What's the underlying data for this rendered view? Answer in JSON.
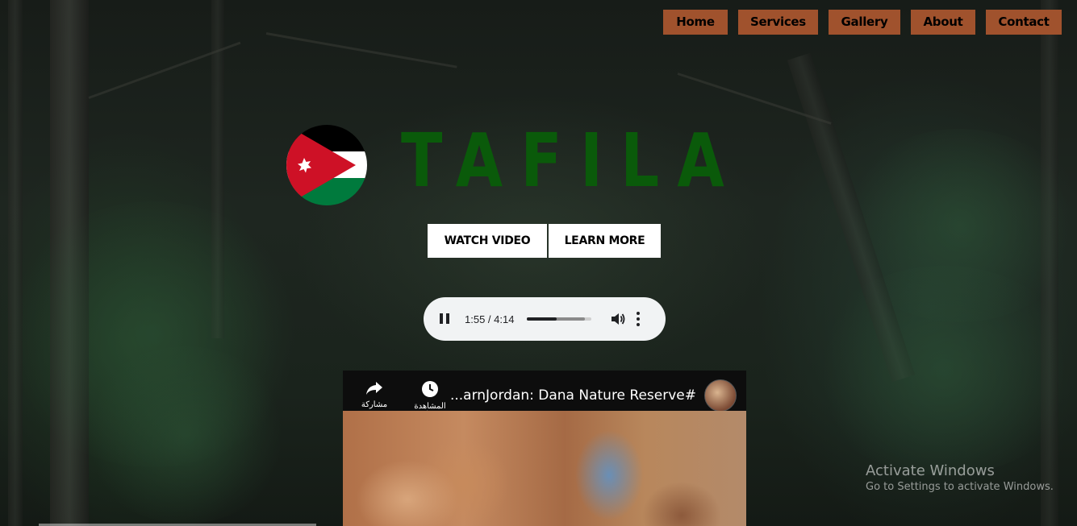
{
  "nav": {
    "items": [
      {
        "label": "Home"
      },
      {
        "label": "Services"
      },
      {
        "label": "Gallery"
      },
      {
        "label": "About"
      },
      {
        "label": "Contact"
      }
    ]
  },
  "hero": {
    "title": "TAFILA",
    "watch_video_label": "WATCH VIDEO",
    "learn_more_label": "LEARN MORE"
  },
  "audio": {
    "time_display": "1:55 / 4:14",
    "progress": 0.4527,
    "buffered": 0.9
  },
  "video": {
    "title": "...arnJordan: Dana Nature Reserve#",
    "share_label": "مشاركة",
    "watch_later_label": "المشاهدة لاحقًا"
  },
  "watermark": {
    "line1": "Activate Windows",
    "line2": "Go to Settings to activate Windows."
  },
  "colors": {
    "nav_bg": "#a0522d",
    "title_green": "#0a5a0a",
    "flag_black": "#000000",
    "flag_white": "#ffffff",
    "flag_green": "#007a3d",
    "flag_red": "#ce1126"
  }
}
